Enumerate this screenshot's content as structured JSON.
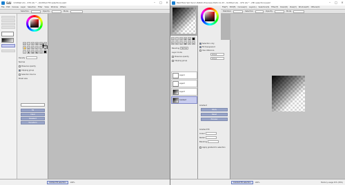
{
  "left_window": {
    "logo_text": "SAI",
    "title": "Untitled (0) - 470 (0) * - [Untitled fill selection].sai2",
    "window_controls": [
      "–",
      "□",
      "×"
    ],
    "menu": [
      "File",
      "Edit",
      "Canvas",
      "Layer",
      "Selection",
      "Filter",
      "View",
      "Window",
      "Others"
    ],
    "toolbar": [
      "Selection",
      "Opacity",
      "Mode"
    ],
    "panel_labels": {
      "normal": "Normal",
      "density": "Density",
      "preserve": "Preserve opacity",
      "clipping": "Clipping group",
      "sample": "Selection Source",
      "brush_size": "Brush size"
    },
    "blue_buttons": [
      "Fill",
      "Clear",
      "Deselect",
      "Transform"
    ],
    "status": {
      "tab": "Untitled fill selection",
      "zoom": "100%",
      "info": ""
    }
  },
  "right_window": {
    "title": "PaintTool SAI Ver.2 (64bit) Preview.2024.11.23 - Untitled (0) - 470 (0) * - [fill selection].sai2",
    "window_controls": [
      "–",
      "□",
      "×"
    ],
    "menu": [
      "File(F)",
      "Edit(E)",
      "Canvas(C)",
      "Layer(L)",
      "Selection(S)",
      "Filter(T)",
      "Ruler(R)",
      "View(V)",
      "Window(W)",
      "Others(O)"
    ],
    "toolbar": [
      "Stabilizer",
      "Selection",
      "Opacity",
      "Mode"
    ],
    "left_panel_labels": {
      "blending": "Blending",
      "normal": "Normal",
      "mode_label": "Layer mode",
      "protect": "Preserve opacity",
      "clip": "Clipping group",
      "layer_names": [
        "Layer1",
        "Layer2",
        "Layer3",
        "Gradient"
      ]
    },
    "mid_panel_labels": {
      "option1": "Selection only",
      "option2": "Fill transparent",
      "option3": "Use reference",
      "value1": "0.0 px",
      "value2": "0.0 px",
      "section": "Gradient",
      "buttons": [
        "Apply",
        "Reset",
        "Preview"
      ],
      "bottom_section": "Gradient fill",
      "bottom_labels": [
        "Linear",
        "Radial",
        "Blending"
      ],
      "footer": "Apply gradient to selection"
    },
    "status": {
      "tab": "Gradient fill selection",
      "zoom": "100%",
      "memory": "Memory usage 32% (39%)"
    }
  },
  "colors": {
    "accent": "#4b7bd0",
    "button_blue": "#9aa6c9",
    "selection_row": "#c9cdf0",
    "canvas_bg": "#bdbdbd"
  }
}
